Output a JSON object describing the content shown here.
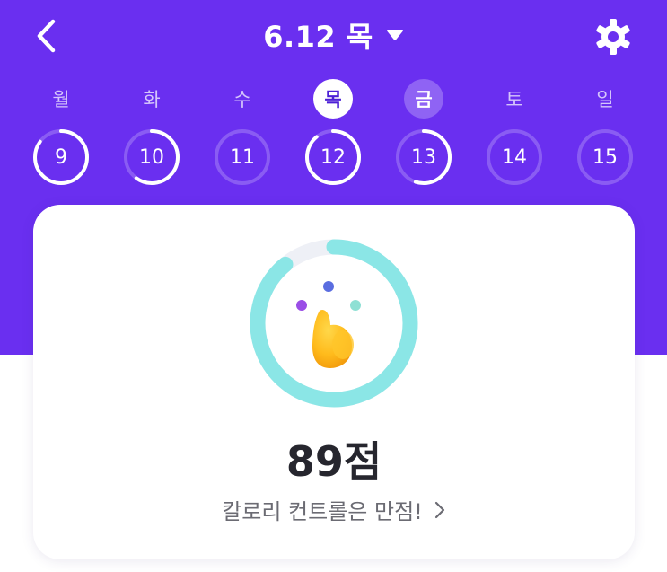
{
  "header": {
    "title": "6.12 목",
    "back_icon": "chevron-left-icon",
    "dropdown_icon": "caret-down-icon",
    "settings_icon": "gear-icon"
  },
  "week": [
    {
      "dow": "월",
      "date": "9",
      "progress": 0.85,
      "state": "normal"
    },
    {
      "dow": "화",
      "date": "10",
      "progress": 0.6,
      "state": "normal"
    },
    {
      "dow": "수",
      "date": "11",
      "progress": 0,
      "state": "normal"
    },
    {
      "dow": "목",
      "date": "12",
      "progress": 0.89,
      "state": "selected"
    },
    {
      "dow": "금",
      "date": "13",
      "progress": 0.55,
      "state": "today"
    },
    {
      "dow": "토",
      "date": "14",
      "progress": 0,
      "state": "normal"
    },
    {
      "dow": "일",
      "date": "15",
      "progress": 0,
      "state": "normal"
    }
  ],
  "card": {
    "score": "89점",
    "score_value": 89,
    "message": "칼로리 컨트롤은 만점!",
    "arrow_icon": "chevron-right-icon",
    "mascot_icon": "mascot-icon"
  },
  "colors": {
    "brand": "#6a2ff0",
    "ring": "#8be6e6",
    "ring_track": "#eef0f6"
  }
}
